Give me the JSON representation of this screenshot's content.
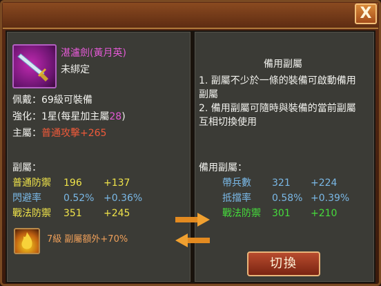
{
  "window": {
    "close_label": "X"
  },
  "left": {
    "item_name": "湛瀘劍(黃月英)",
    "bind_status": "未綁定",
    "equip_req": "佩戴：69級可裝備",
    "enhance_prefix": "強化：1星(每星加主屬",
    "enhance_value": "28",
    "enhance_suffix": ")",
    "main_label": "主屬：",
    "main_value": "普通攻擊+265",
    "sub_header": "副屬：",
    "stats": [
      {
        "name": "普通防禦",
        "value": "196",
        "bonus": "+137"
      },
      {
        "name": "閃避率",
        "value": "0.52%",
        "bonus": "+0.36%"
      },
      {
        "name": "戰法防禦",
        "value": "351",
        "bonus": "+245"
      }
    ],
    "extra_text": "7級 副屬額外+70%"
  },
  "right": {
    "title": "備用副屬",
    "desc1": "1. 副屬不少於一條的裝備可啟動備用副屬",
    "desc1_line1": "1. 副屬不少於一條的裝備可啟動備用",
    "desc1_line2": "副屬",
    "desc2_line1": "2. 備用副屬可隨時與裝備的當前副屬",
    "desc2_line2": "互相切換使用",
    "sub_header": "備用副屬：",
    "stats": [
      {
        "name": "帶兵數",
        "value": "321",
        "bonus": "+224"
      },
      {
        "name": "抵擋率",
        "value": "0.58%",
        "bonus": "+0.39%"
      },
      {
        "name": "戰法防禦",
        "value": "301",
        "bonus": "+210"
      }
    ],
    "switch_label": "切換"
  }
}
